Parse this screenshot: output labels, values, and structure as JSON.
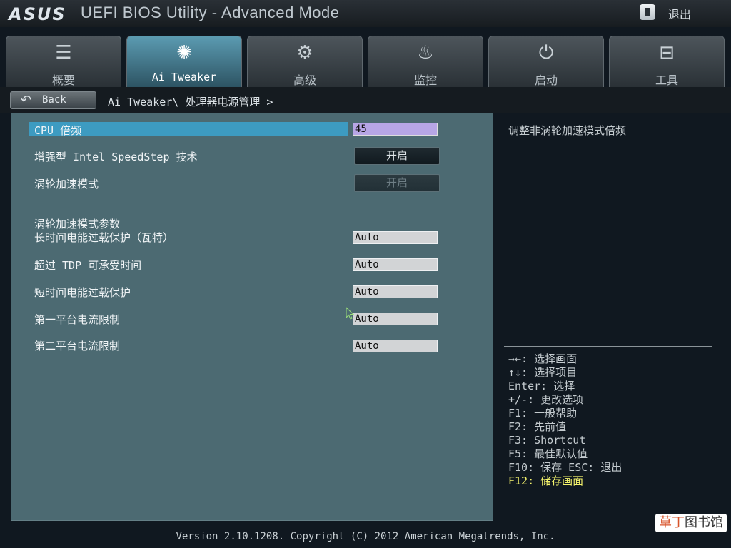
{
  "title_bar": {
    "logo": "ASUS",
    "title": "UEFI BIOS Utility - Advanced Mode",
    "exit_label": "退出"
  },
  "tabs": [
    {
      "label": "概要",
      "icon": "list-icon",
      "active": false
    },
    {
      "label": "Ai Tweaker",
      "icon": "ai-tweaker-icon",
      "active": true
    },
    {
      "label": "高级",
      "icon": "advanced-icon",
      "active": false
    },
    {
      "label": "监控",
      "icon": "monitor-icon",
      "active": false
    },
    {
      "label": "启动",
      "icon": "power-icon",
      "active": false
    },
    {
      "label": "工具",
      "icon": "toolbox-icon",
      "active": false
    }
  ],
  "nav": {
    "back_label": "Back",
    "breadcrumb": "Ai Tweaker\\ 处理器电源管理 >"
  },
  "settings": {
    "cpu_ratio": {
      "label": "CPU 倍频",
      "value": "45"
    },
    "speedstep": {
      "label": "增强型 Intel SpeedStep 技术",
      "value": "开启"
    },
    "turbo_mode": {
      "label": "涡轮加速模式",
      "value": "开启",
      "disabled": true
    },
    "section_title": "涡轮加速模式参数",
    "long_power": {
      "label": "长时间电能过载保护（瓦特）",
      "value": "Auto"
    },
    "tdp_time": {
      "label": "超过 TDP 可承受时间",
      "value": "Auto"
    },
    "short_power": {
      "label": "短时间电能过载保护",
      "value": "Auto"
    },
    "primary_current": {
      "label": "第一平台电流限制",
      "value": "Auto"
    },
    "secondary_current": {
      "label": "第二平台电流限制",
      "value": "Auto"
    }
  },
  "help": {
    "description": "调整非涡轮加速模式倍频",
    "keys": [
      "→←: 选择画面",
      "↑↓: 选择项目",
      "Enter: 选择",
      "+/-: 更改选项",
      "F1: 一般帮助",
      "F2: 先前值",
      "F3: Shortcut",
      "F5: 最佳默认值",
      "F10: 保存  ESC: 退出"
    ],
    "highlight_key": "F12: 储存画面"
  },
  "footer": {
    "version_text": "Version 2.10.1208. Copyright (C) 2012 American Megatrends, Inc."
  },
  "watermark": {
    "text_accent": "草丁",
    "text_rest": "图书馆"
  },
  "colors": {
    "accent": "#3d9bc1",
    "active_tab": "#5b9bb1",
    "panel": "#4c6a72",
    "selected_field": "#b7a6e6",
    "highlight_key": "#f4f36c"
  }
}
